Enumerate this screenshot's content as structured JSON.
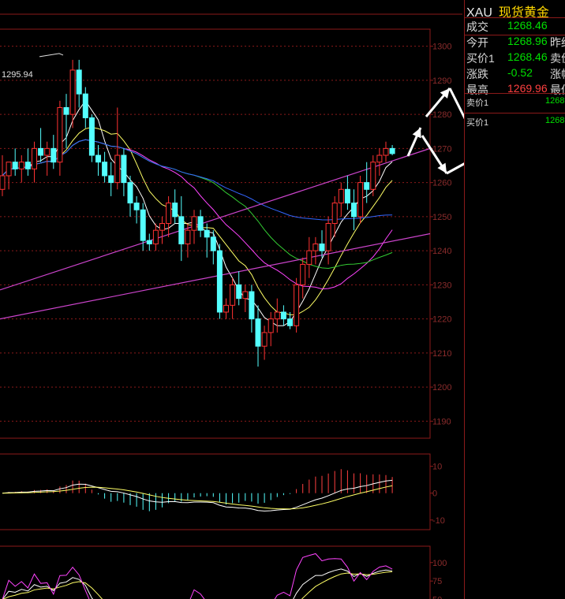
{
  "quote": {
    "symbol": "XAU",
    "name": "现货黄金",
    "rows": [
      {
        "label": "成交",
        "value": "1268.46",
        "color": "#00e000",
        "label2": "",
        "sep": true
      },
      {
        "label": "今开",
        "value": "1268.96",
        "color": "#00e000",
        "label2": "昨结",
        "sep": false
      },
      {
        "label": "买价1",
        "value": "1268.46",
        "color": "#00e000",
        "label2": "卖价",
        "sep": false
      },
      {
        "label": "涨跌",
        "value": "-0.52",
        "color": "#00e000",
        "label2": "涨幅",
        "sep": false
      },
      {
        "label": "最高",
        "value": "1269.96",
        "color": "#ff4040",
        "label2": "最低",
        "sep": false
      }
    ],
    "orderbook": [
      {
        "label": "卖价1",
        "value": "1268"
      },
      {
        "label": "买价1",
        "value": "1268"
      }
    ]
  },
  "chart_data": {
    "type": "candlestick",
    "peak_annotation": "1295.94",
    "price_axis": {
      "min": 1185,
      "max": 1305,
      "ticks": [
        1300,
        1290,
        1280,
        1270,
        1260,
        1250,
        1240,
        1230,
        1220,
        1210,
        1200,
        1190
      ]
    },
    "macd_axis": {
      "min": -13,
      "max": 14,
      "ticks": [
        10,
        0,
        -10
      ]
    },
    "kdj_axis": {
      "min": 40,
      "max": 120,
      "ticks": [
        100,
        75,
        50
      ]
    },
    "candles": [
      [
        1258,
        1268,
        1256,
        1262
      ],
      [
        1262,
        1265,
        1258,
        1266
      ],
      [
        1266,
        1270,
        1262,
        1264
      ],
      [
        1264,
        1268,
        1260,
        1266
      ],
      [
        1266,
        1270,
        1262,
        1264
      ],
      [
        1264,
        1272,
        1260,
        1270
      ],
      [
        1270,
        1276,
        1266,
        1268
      ],
      [
        1268,
        1272,
        1262,
        1270
      ],
      [
        1270,
        1274,
        1264,
        1266
      ],
      [
        1266,
        1284,
        1262,
        1282
      ],
      [
        1282,
        1286,
        1270,
        1280
      ],
      [
        1280,
        1296,
        1276,
        1293
      ],
      [
        1293,
        1296,
        1282,
        1286
      ],
      [
        1286,
        1288,
        1276,
        1279
      ],
      [
        1279,
        1280,
        1266,
        1268
      ],
      [
        1268,
        1271,
        1262,
        1266
      ],
      [
        1266,
        1269,
        1260,
        1262
      ],
      [
        1262,
        1266,
        1256,
        1260
      ],
      [
        1260,
        1282,
        1258,
        1268
      ],
      [
        1268,
        1270,
        1256,
        1260
      ],
      [
        1260,
        1262,
        1250,
        1254
      ],
      [
        1254,
        1256,
        1248,
        1252
      ],
      [
        1252,
        1254,
        1240,
        1243
      ],
      [
        1243,
        1245,
        1240,
        1242
      ],
      [
        1242,
        1248,
        1240,
        1246
      ],
      [
        1246,
        1250,
        1242,
        1248
      ],
      [
        1248,
        1256,
        1244,
        1254
      ],
      [
        1254,
        1258,
        1248,
        1250
      ],
      [
        1250,
        1256,
        1237,
        1242
      ],
      [
        1242,
        1248,
        1238,
        1246
      ],
      [
        1246,
        1252,
        1242,
        1250
      ],
      [
        1250,
        1252,
        1244,
        1246
      ],
      [
        1246,
        1248,
        1238,
        1244
      ],
      [
        1244,
        1246,
        1236,
        1240
      ],
      [
        1240,
        1242,
        1220,
        1222
      ],
      [
        1222,
        1226,
        1220,
        1224
      ],
      [
        1224,
        1232,
        1220,
        1230
      ],
      [
        1230,
        1234,
        1224,
        1226
      ],
      [
        1226,
        1230,
        1222,
        1228
      ],
      [
        1228,
        1230,
        1216,
        1220
      ],
      [
        1220,
        1224,
        1206,
        1212
      ],
      [
        1212,
        1218,
        1208,
        1216
      ],
      [
        1216,
        1222,
        1212,
        1220
      ],
      [
        1220,
        1226,
        1216,
        1222
      ],
      [
        1222,
        1224,
        1218,
        1220
      ],
      [
        1220,
        1222,
        1217,
        1218
      ],
      [
        1218,
        1232,
        1216,
        1230
      ],
      [
        1230,
        1238,
        1226,
        1236
      ],
      [
        1236,
        1244,
        1232,
        1240
      ],
      [
        1240,
        1244,
        1236,
        1242
      ],
      [
        1242,
        1246,
        1238,
        1240
      ],
      [
        1240,
        1250,
        1236,
        1248
      ],
      [
        1248,
        1256,
        1244,
        1254
      ],
      [
        1254,
        1260,
        1250,
        1258
      ],
      [
        1258,
        1262,
        1252,
        1254
      ],
      [
        1254,
        1258,
        1246,
        1250
      ],
      [
        1250,
        1262,
        1248,
        1260
      ],
      [
        1260,
        1266,
        1254,
        1258
      ],
      [
        1258,
        1268,
        1256,
        1266
      ],
      [
        1266,
        1270,
        1262,
        1268
      ],
      [
        1268,
        1272,
        1266,
        1270
      ],
      [
        1270,
        1271,
        1268,
        1268.5
      ]
    ]
  }
}
